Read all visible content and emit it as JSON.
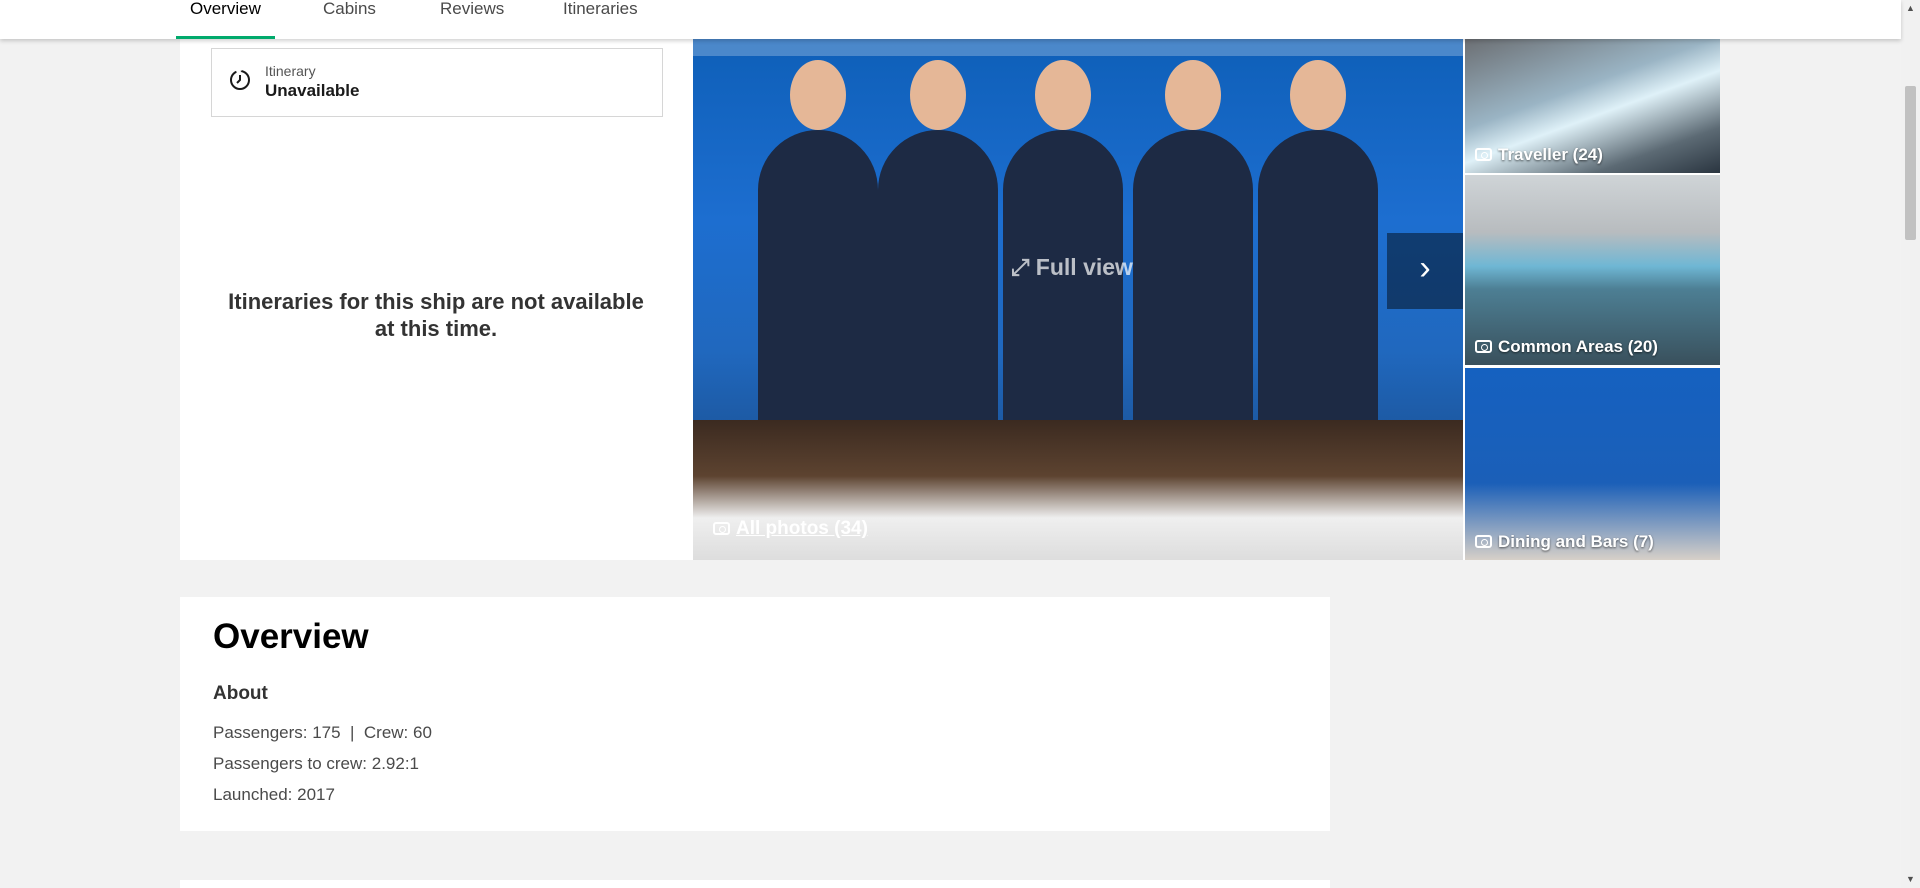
{
  "tabs": [
    {
      "label": "Overview",
      "active": true
    },
    {
      "label": "Cabins",
      "active": false
    },
    {
      "label": "Reviews",
      "active": false
    },
    {
      "label": "Itineraries",
      "active": false
    }
  ],
  "itinerary": {
    "label": "Itinerary",
    "value": "Unavailable",
    "icon": "clock-icon"
  },
  "unavailable_message": "Itineraries for this ship are not available at this time.",
  "gallery": {
    "full_view_label": "Full view",
    "all_photos_label": "All photos (34)",
    "next_icon": "chevron-right-icon",
    "thumbnails": [
      {
        "label": "Traveller (24)"
      },
      {
        "label": "Common Areas (20)"
      },
      {
        "label": "Dining and Bars (7)"
      }
    ]
  },
  "overview": {
    "title": "Overview",
    "about_heading": "About",
    "passengers_crew": "Passengers: 175  |  Crew: 60",
    "ratio": "Passengers to crew: 2.92:1",
    "launched": "Launched: 2017"
  },
  "colors": {
    "accent": "#00aa6c",
    "background": "#f2f2f2"
  }
}
